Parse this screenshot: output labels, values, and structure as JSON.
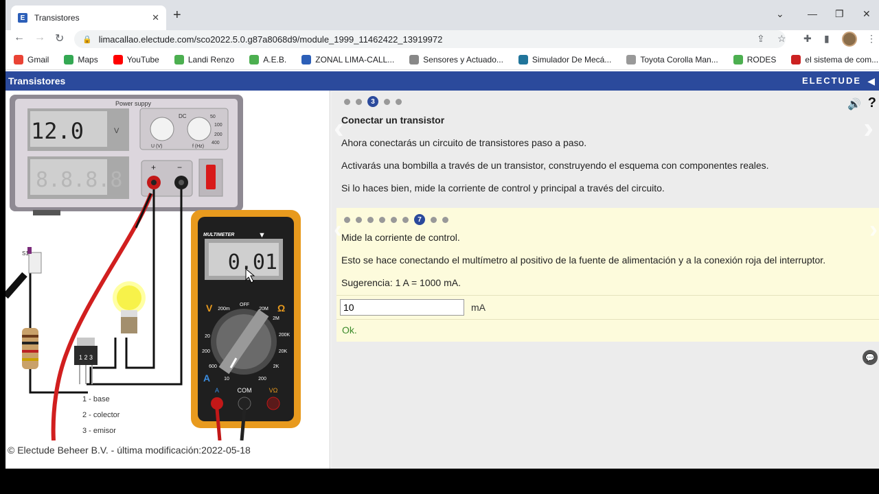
{
  "browser": {
    "tab_title": "Transistores",
    "tab_close": "✕",
    "new_tab": "+",
    "url": "limacallao.electude.com/sco2022.5.0.g87a8068d9/module_1999_11462422_13919972",
    "bookmarks": [
      {
        "label": "Gmail",
        "icon": "gmail-icon",
        "color": "#ea4335"
      },
      {
        "label": "Maps",
        "icon": "maps-pin-icon",
        "color": "#34a853"
      },
      {
        "label": "YouTube",
        "icon": "youtube-icon",
        "color": "#ff0000"
      },
      {
        "label": "Landi Renzo",
        "icon": "leaf-icon",
        "color": "#4caf50"
      },
      {
        "label": "A.E.B.",
        "icon": "leaf-icon",
        "color": "#4caf50"
      },
      {
        "label": "ZONAL LIMA-CALL...",
        "icon": "electude-icon",
        "color": "#2c5fb8"
      },
      {
        "label": "Sensores y Actuado...",
        "icon": "link-icon",
        "color": "#888888"
      },
      {
        "label": "Simulador De Mecá...",
        "icon": "wordpress-icon",
        "color": "#21759b"
      },
      {
        "label": "Toyota Corolla Man...",
        "icon": "toyota-icon",
        "color": "#999999"
      },
      {
        "label": "RODES",
        "icon": "leaf-icon",
        "color": "#4caf50"
      },
      {
        "label": "el sistema de com...",
        "icon": "tesla-icon",
        "color": "#cc2222"
      }
    ]
  },
  "app": {
    "title": "Transistores",
    "brand": "ELECTUDE",
    "collapse_icon": "◀",
    "speaker_icon": "🔊",
    "help_icon": "?",
    "colors": {
      "header": "#2b4a9c",
      "answer_box": "#fdfbdc",
      "feedback": "#3a8a2a"
    }
  },
  "simulation": {
    "power_supply_label": "Power suppy",
    "voltage_display": "12.0",
    "voltage_unit": "V",
    "current_display": "8.8.8.8",
    "knob_labels": {
      "dc": "DC",
      "u": "U (V)",
      "f": "f (Hz)",
      "f_values": [
        "50",
        "100",
        "200",
        "400"
      ]
    },
    "terminal_plus": "+",
    "terminal_minus": "−",
    "multimeter_label": "MULTIMETER",
    "multimeter_display": "0.01",
    "multimeter_ranges": [
      "OFF",
      "200m",
      "2M",
      "20M",
      "20",
      "200K",
      "200",
      "20K",
      "600",
      "2K",
      "10",
      "200"
    ],
    "multimeter_modes": {
      "v": "V",
      "ohm": "Ω",
      "a": "A"
    },
    "multimeter_ports": [
      "A",
      "COM",
      "VΩ"
    ],
    "transistor_label": "1 2 3",
    "pins": [
      "1 - base",
      "2 - colector",
      "3 - emisor"
    ],
    "switch_label": "S1",
    "copyright": "© Electude Beheer B.V. - última modificación:2022-05-18"
  },
  "lesson": {
    "step_dots": {
      "count": 5,
      "active_index": 2,
      "active_label": "3"
    },
    "step_title": "Conectar un transistor",
    "paragraphs": [
      "Ahora conectarás un circuito de transistores paso a paso.",
      "Activarás una bombilla a través de un transistor, construyendo el esquema con componentes reales.",
      "Si lo haces bien, mide la corriente de control y principal a través del circuito."
    ],
    "substep_dots": {
      "count": 9,
      "active_index": 6,
      "active_label": "7"
    },
    "task_paragraphs": [
      "Mide la corriente de control.",
      "Esto se hace conectando el multímetro al positivo de la fuente de alimentación y a la conexión roja del interruptor.",
      "Sugerencia: 1 A = 1000 mA."
    ],
    "answer_value": "10",
    "answer_unit": "mA",
    "feedback": "Ok."
  }
}
